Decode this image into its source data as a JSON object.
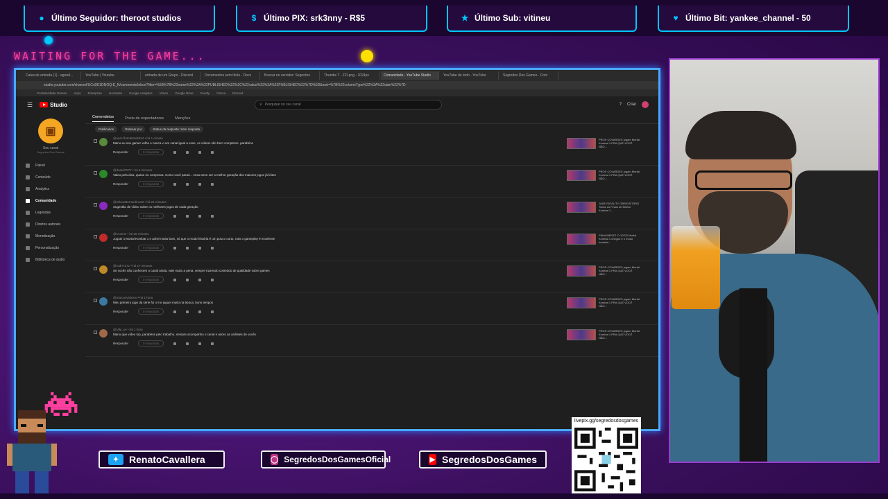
{
  "overlay": {
    "top_boxes": [
      {
        "icon": "user-icon",
        "label": "Último Seguidor: theroot studios"
      },
      {
        "icon": "dollar-icon",
        "label": "Último PIX: srk3nny - R$5"
      },
      {
        "icon": "star-icon",
        "label": "Último Sub: vitineu"
      },
      {
        "icon": "heart-icon",
        "label": "Último Bit: yankee_channel - 50"
      }
    ],
    "waiting_text": "WAITING FOR THE GAME...",
    "socials": [
      {
        "icon": "twitter-icon",
        "label": "RenatoCavallera"
      },
      {
        "icon": "instagram-icon",
        "label": "SegredosDosGamesOficial"
      },
      {
        "icon": "youtube-icon",
        "label": "SegredosDosGames"
      }
    ],
    "qr_label": "livepix.gg/segredosdosgames",
    "colors": {
      "accent_cyan": "#00c8ff",
      "accent_pink": "#ff3fa0",
      "frame_blue": "#4aa8ff",
      "purple_bg": "#3a0f5c"
    }
  },
  "browser": {
    "tabs": [
      "Caixa de entrada (1) - agend...",
      "YouTube | Youtube",
      "entrada de um Grupo - Discord",
      "Documentos sem título - Docs",
      "Buscar no servidor: Segredos",
      "Thumbs T - ZZI.png - 1024px",
      "Comunidade - YouTube Studio",
      "YouTube de todo - YouTube",
      "Segredos Dos Games - Com"
    ],
    "active_tab_index": 6,
    "url": "studio.youtube.com/channel/UCvDE3DNOQ-E_N/comments/inbox?filter=%5B%7B%22name%22%3A%22PUBLISHED%22%2C%22value%22%3A%22PUBLISHED%22%7D%5D&sort=%7B%22columnType%22%3A%22date%22%7D",
    "bookmarks": [
      "Produtividade Games",
      "Apps",
      "Enterprise",
      "Hootsuite",
      "Google Analytics",
      "Vimeo",
      "Google Drive",
      "Feedly",
      "Canva",
      "Discord"
    ]
  },
  "studio": {
    "logo_text": "Studio",
    "search_placeholder": "Pesquisar no seu canal",
    "create_label": "Criar",
    "channel_name": "Seu canal",
    "channel_handle": "Segredos Dos Games",
    "sidebar": [
      {
        "icon": "dashboard-icon",
        "label": "Painel"
      },
      {
        "icon": "content-icon",
        "label": "Conteúdo"
      },
      {
        "icon": "analytics-icon",
        "label": "Analytics"
      },
      {
        "icon": "community-icon",
        "label": "Comunidade"
      },
      {
        "icon": "subtitles-icon",
        "label": "Legendas"
      },
      {
        "icon": "copyright-icon",
        "label": "Direitos autorais"
      },
      {
        "icon": "money-icon",
        "label": "Monetização"
      },
      {
        "icon": "customize-icon",
        "label": "Personalização"
      },
      {
        "icon": "audio-icon",
        "label": "Biblioteca de áudio"
      }
    ],
    "active_sidebar_index": 3,
    "tabs": [
      "Comentários",
      "Posts de espectadores",
      "Menções"
    ],
    "active_tab_index": 0,
    "filters": [
      "Publicados",
      "Ordenar por",
      "Status da resposta: Sem resposta"
    ],
    "reply_label": "Responder",
    "responses_label": "0 respostas",
    "comments": [
      {
        "avatar_color": "#5a8a3a",
        "meta": "@user-fh4mk8so5024 • há 1 minuto",
        "text": "Mano eu sou gamer velho e nunca vi um canal igual a esse, os vídeos são bem completos, parabéns",
        "video": "PROS COVARDES jogam Mortal Kombat 1 PRA QUE VOCÊ NÃO..."
      },
      {
        "avatar_color": "#2a8a2a",
        "meta": "@daniel7677 • há 6 minutos",
        "text": "Valeu pela dica, quase eu comprava. Como você paraú... essa amor ser a melhor geração dos maiores jogos já feitos",
        "video": "PROS COVARDES jogam Mortal Kombat 1 PRA QUE VOCÊ NÃO..."
      },
      {
        "avatar_color": "#8a2ac0",
        "meta": "@GilsonBernardino62 • há 21 minutos",
        "text": "Sugestão de vídeo sobre os melhores jogos de cada geração",
        "video": "JADE FATALITY OBRIGATÓRIO Todos os Finais de Mortal Kombat 1..."
      },
      {
        "avatar_color": "#c02a2a",
        "meta": "@rcosme • há 25 minutos",
        "text": "Joguei o Mortal Kombat 1 e achei muito bom, só que o modo história é um pouco curto, mas o gameplay é excelente",
        "video": "FINALMENTE O JOGO Mortal Kombat 1 chegou e o modo Invasão..."
      },
      {
        "avatar_color": "#c08a2a",
        "meta": "@rodrr7271 • há 27 minutos",
        "text": "Se vocês não conhecem o canal ainda, vale muito a pena, sempre trazendo conteúdo de qualidade sobre games",
        "video": "PROS COVARDES jogam Mortal Kombat 1 PRA QUE VOCÊ NÃO..."
      },
      {
        "avatar_color": "#3a7aa0",
        "meta": "@marcosvinicius • há 1 hora",
        "text": "Meu primeiro jogo da série foi o 9 e joguei muito na época, bons tempos",
        "video": "PROS COVARDES jogam Mortal Kombat 1 PRA QUE VOCÊ NÃO..."
      },
      {
        "avatar_color": "#a06a4a",
        "meta": "@rafa_ov • há 1 hora",
        "text": "Mano que vídeo top, parabéns pelo trabalho, sempre acompanho o canal e adoro as análises de vocês",
        "video": "PROS COVARDES jogam Mortal Kombat 1 PRA QUE VOCÊ NÃO..."
      }
    ]
  }
}
